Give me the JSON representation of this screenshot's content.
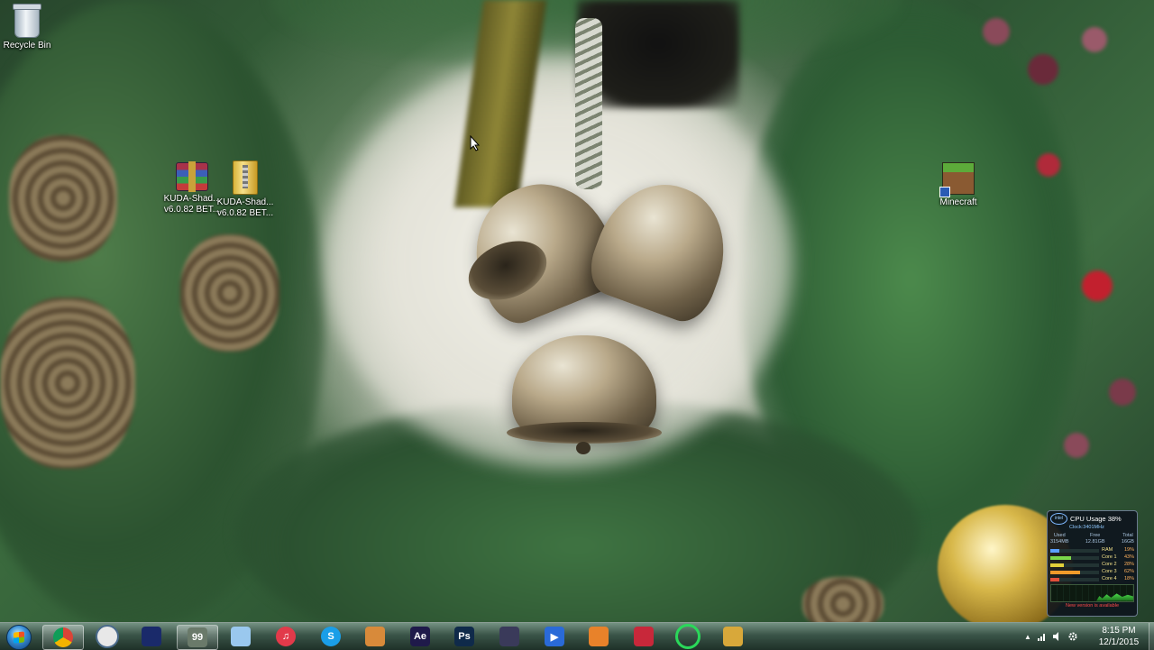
{
  "desktop": {
    "icons": [
      {
        "label": "Recycle Bin",
        "icon": "recycle-bin-icon"
      },
      {
        "label": "KUDA-Shad...\nv6.0.82 BET...",
        "label_line1": "KUDA-Shad...",
        "label_line2": "v6.0.82 BET...",
        "icon": "winrar-archive-icon"
      },
      {
        "label_line1": "KUDA-Shad...",
        "label_line2": "v6.0.82 BET...",
        "icon": "zip-folder-icon"
      },
      {
        "label": "Minecraft",
        "icon": "minecraft-icon"
      }
    ]
  },
  "cpu_gadget": {
    "title": "CPU Usage",
    "usage": "38%",
    "clock": "Clock:3401MHz",
    "logo": "intel",
    "mem_headers": [
      "Used",
      "Free",
      "Total"
    ],
    "mem_values": [
      "3154MB",
      "12.81GB",
      "16GB"
    ],
    "rows": [
      {
        "label": "RAM",
        "value": "19%",
        "fill": 0.19,
        "color": "#5aa0ff"
      },
      {
        "label": "Core 1",
        "value": "43%",
        "fill": 0.43,
        "color": "#7cd84a"
      },
      {
        "label": "Core 2",
        "value": "28%",
        "fill": 0.28,
        "color": "#e2d03a"
      },
      {
        "label": "Core 3",
        "value": "62%",
        "fill": 0.62,
        "color": "#f09a2a"
      },
      {
        "label": "Core 4",
        "value": "18%",
        "fill": 0.18,
        "color": "#e2503a"
      }
    ],
    "update_text": "New version is available"
  },
  "taskbar": {
    "start_icon": "windows-start-orb-icon",
    "apps": [
      {
        "name": "chrome",
        "icon": "chrome-icon",
        "glyph": "",
        "color": "#4a8cf0",
        "active": true
      },
      {
        "name": "clock",
        "icon": "clock-icon",
        "glyph": "",
        "color": "#e8e8e8",
        "active": false
      },
      {
        "name": "monitor",
        "icon": "monitor-icon",
        "glyph": "",
        "color": "#1a2a6a",
        "active": false
      },
      {
        "name": "benchmark",
        "icon": "cpu-benchmark-icon",
        "glyph": "99",
        "color": "#6a7a6a",
        "active": true
      },
      {
        "name": "notepad",
        "icon": "notepad-icon",
        "glyph": "",
        "color": "#9ac8ee",
        "active": false
      },
      {
        "name": "itunes",
        "icon": "itunes-icon",
        "glyph": "♫",
        "color": "#e23a4a",
        "active": false
      },
      {
        "name": "skype",
        "icon": "skype-icon",
        "glyph": "S",
        "color": "#1a9ee8",
        "active": false
      },
      {
        "name": "box",
        "icon": "package-icon",
        "glyph": "",
        "color": "#d88a3a",
        "active": false
      },
      {
        "name": "after-effects",
        "icon": "after-effects-icon",
        "glyph": "Ae",
        "color": "#1f1a4a",
        "active": false
      },
      {
        "name": "photoshop",
        "icon": "photoshop-icon",
        "glyph": "Ps",
        "color": "#0f2a4a",
        "active": false
      },
      {
        "name": "video-editor",
        "icon": "video-editor-icon",
        "glyph": "",
        "color": "#3a3a5a",
        "active": false
      },
      {
        "name": "media-player",
        "icon": "media-player-icon",
        "glyph": "▶",
        "color": "#2a6ad8",
        "active": false
      },
      {
        "name": "blender",
        "icon": "blender-icon",
        "glyph": "",
        "color": "#e8822a",
        "active": false
      },
      {
        "name": "headset",
        "icon": "headset-icon",
        "glyph": "",
        "color": "#c8283a",
        "active": false
      },
      {
        "name": "razer",
        "icon": "razer-icon",
        "glyph": "",
        "color": "#2ad85a",
        "active": false
      },
      {
        "name": "fruit",
        "icon": "pineapple-icon",
        "glyph": "",
        "color": "#d8a83a",
        "active": false
      }
    ],
    "clock_time": "8:15 PM",
    "clock_date": "12/1/2015"
  }
}
